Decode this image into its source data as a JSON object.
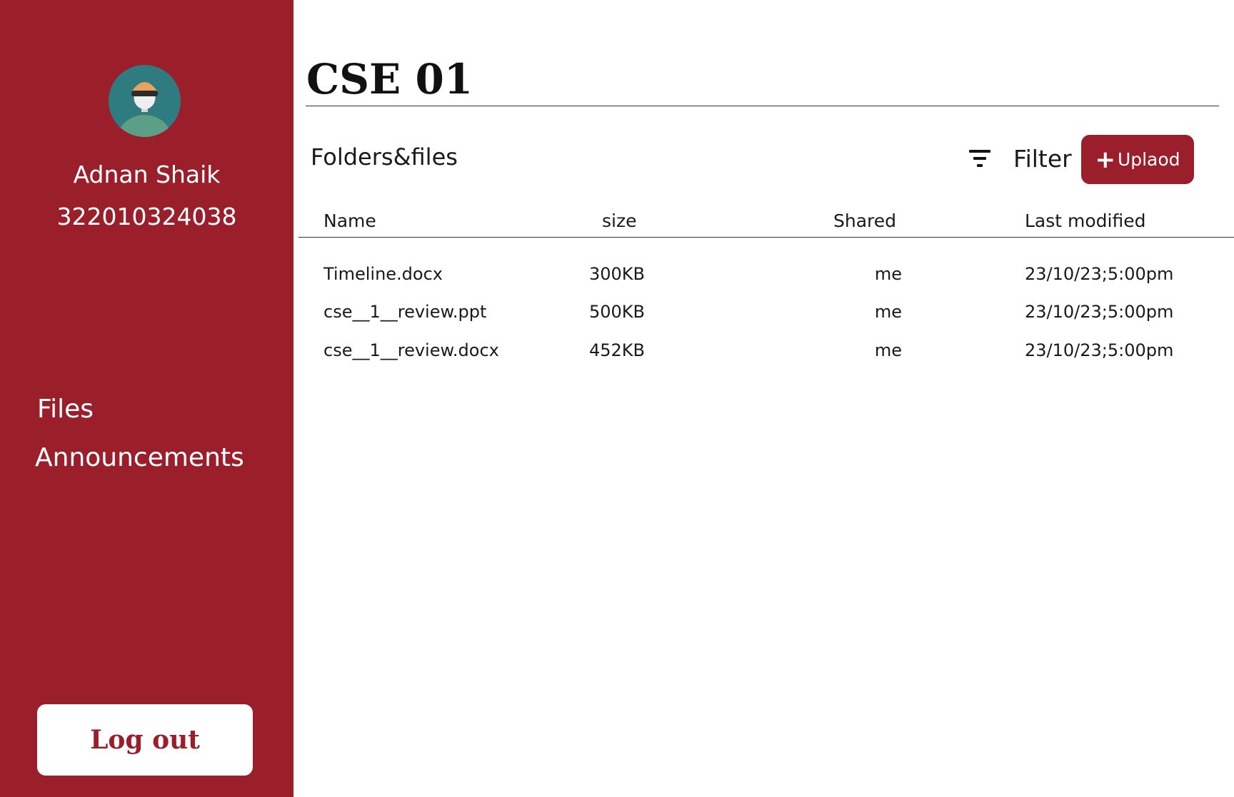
{
  "sidebar": {
    "user": {
      "name": "Adnan Shaik",
      "id": "322010324038"
    },
    "nav": [
      {
        "label": "Files"
      },
      {
        "label": "Announcements"
      }
    ],
    "logout_label": "Log out"
  },
  "main": {
    "title": "CSE 01",
    "section_label": "Folders&files",
    "filter_label": "Filter",
    "upload_label": "Uplaod",
    "table": {
      "headers": [
        "Name",
        "size",
        "Shared",
        "Last modified"
      ],
      "rows": [
        {
          "name": "Timeline.docx",
          "size": "300KB",
          "shared": "me",
          "modified": "23/10/23;5:00pm"
        },
        {
          "name": "cse__1__review.ppt",
          "size": "500KB",
          "shared": "me",
          "modified": "23/10/23;5:00pm"
        },
        {
          "name": "cse__1__review.docx",
          "size": "452KB",
          "shared": "me",
          "modified": "23/10/23;5:00pm"
        }
      ]
    }
  },
  "colors": {
    "accent": "#9b1f2a",
    "background": "#ffffff",
    "text": "#1a1a1a"
  },
  "icons": [
    "avatar",
    "filter-icon",
    "plus-icon"
  ]
}
